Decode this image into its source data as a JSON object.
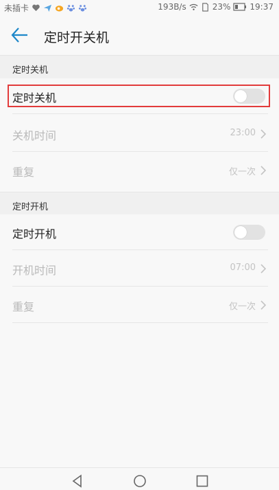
{
  "status_bar": {
    "carrier": "未插卡",
    "network_speed": "193B/s",
    "battery": "23%",
    "time": "19:37"
  },
  "header": {
    "title": "定时开关机"
  },
  "shutdown_section": {
    "title": "定时关机",
    "toggle_label": "定时关机",
    "toggle_on": false,
    "time_label": "关机时间",
    "time_value": "23:00",
    "repeat_label": "重复",
    "repeat_value": "仅一次"
  },
  "startup_section": {
    "title": "定时开机",
    "toggle_label": "定时开机",
    "toggle_on": false,
    "time_label": "开机时间",
    "time_value": "07:00",
    "repeat_label": "重复",
    "repeat_value": "仅一次"
  },
  "colors": {
    "accent": "#1e88c9",
    "highlight": "#e23b3b"
  }
}
